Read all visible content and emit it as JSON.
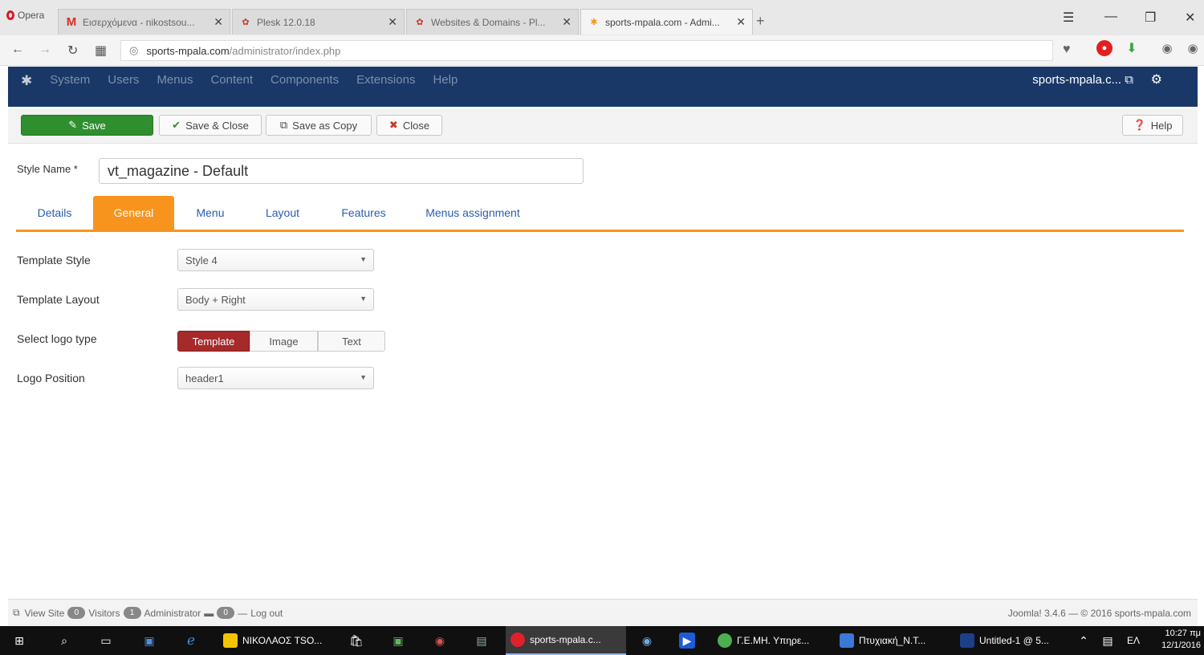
{
  "browser": {
    "menu_label": "Opera",
    "tabs": [
      {
        "title": "Εισερχόμενα - nikostsou...",
        "icon": "gmail-icon"
      },
      {
        "title": "Plesk 12.0.18",
        "icon": "plesk-icon"
      },
      {
        "title": "Websites & Domains - Pl...",
        "icon": "plesk-icon"
      },
      {
        "title": "sports-mpala.com - Admi...",
        "icon": "joomla-icon"
      }
    ],
    "url_host": "sports-mpala.com",
    "url_path": "/administrator/index.php"
  },
  "admin_nav": {
    "menu": [
      "System",
      "Users",
      "Menus",
      "Content",
      "Components",
      "Extensions",
      "Help"
    ],
    "site_link": "sports-mpala.c..."
  },
  "toolbar": {
    "save": "Save",
    "save_close": "Save & Close",
    "save_copy": "Save as Copy",
    "close": "Close",
    "help": "Help"
  },
  "form": {
    "style_name_label": "Style Name *",
    "style_name_value": "vt_magazine - Default",
    "tabs": [
      "Details",
      "General",
      "Menu",
      "Layout",
      "Features",
      "Menus assignment"
    ],
    "active_tab": "General",
    "fields": {
      "template_style_label": "Template Style",
      "template_style_value": "Style 4",
      "template_layout_label": "Template Layout",
      "template_layout_value": "Body + Right",
      "logo_type_label": "Select logo type",
      "logo_type_options": [
        "Template",
        "Image",
        "Text"
      ],
      "logo_type_selected": "Template",
      "logo_position_label": "Logo Position",
      "logo_position_value": "header1"
    }
  },
  "statusbar": {
    "view_site": "View Site",
    "visitors_count": "0",
    "visitors": "Visitors",
    "admin_count": "1",
    "administrator": "Administrator",
    "logout_count": "0",
    "logout": "Log out",
    "footer": "Joomla! 3.4.6 — © 2016 sports-mpala.com"
  },
  "taskbar": {
    "apps": [
      {
        "label": "ΝΙΚΟΛΑΟΣ TSO...",
        "color": "#f5c400"
      },
      {
        "label": "sports-mpala.c...",
        "color": "#e0202a"
      },
      {
        "label": "Γ.Ε.ΜΗ. Υπηρε...",
        "color": "#4caf50"
      },
      {
        "label": "Πτυχιακή_Ν.Τ...",
        "color": "#3b78d8"
      },
      {
        "label": "Untitled-1 @ 5...",
        "color": "#1c3f8a"
      }
    ],
    "lang": "ΕΛ",
    "time": "10:27 πμ",
    "date": "12/1/2016"
  },
  "colors": {
    "admin_nav_bg": "#1a3867",
    "accent_orange": "#f7941d",
    "save_green": "#2f8f2f",
    "selected_red": "#a52a2a"
  }
}
